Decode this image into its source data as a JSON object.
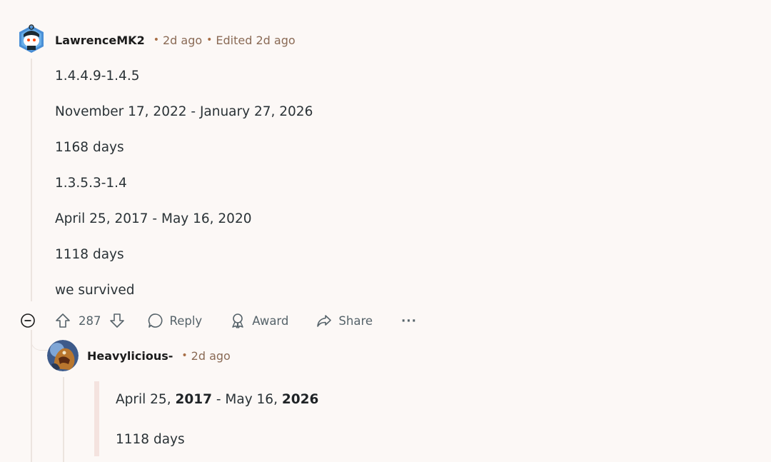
{
  "comment": {
    "author": "LawrenceMK2",
    "time": "2d ago",
    "edited": "Edited 2d ago",
    "body": [
      "1.4.4.9-1.4.5",
      "November 17, 2022 - January 27, 2026",
      "1168 days",
      "1.3.5.3-1.4",
      "April 25, 2017 - May 16, 2020",
      "1118 days",
      "we survived"
    ],
    "actions": {
      "score": "287",
      "reply": "Reply",
      "award": "Award",
      "share": "Share",
      "more": "···"
    }
  },
  "reply": {
    "author": "Heavylicious-",
    "time": "2d ago",
    "quote": {
      "line1_a": "April 25, ",
      "line1_b": "2017",
      "line1_c": " - May 16, ",
      "line1_d": "2026",
      "line2": "1118 days"
    }
  },
  "colors": {
    "background": "#fcf8f6",
    "meta": "#8a6a55",
    "action": "#56636a",
    "thread_line": "#ece4df",
    "quote_bar": "#f4e3df"
  }
}
